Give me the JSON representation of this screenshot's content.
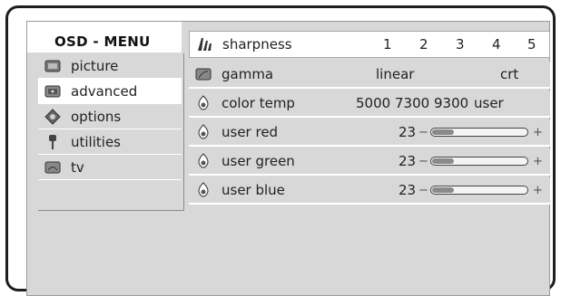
{
  "osd": {
    "title": "OSD - MENU",
    "menu": [
      {
        "label": "picture",
        "icon": "picture-icon",
        "active": false
      },
      {
        "label": "advanced",
        "icon": "advanced-icon",
        "active": true
      },
      {
        "label": "options",
        "icon": "options-icon",
        "active": false
      },
      {
        "label": "utilities",
        "icon": "utilities-icon",
        "active": false
      },
      {
        "label": "tv",
        "icon": "tv-icon",
        "active": false
      }
    ],
    "rows": {
      "sharpness": {
        "label": "sharpness",
        "options": [
          "1",
          "2",
          "3",
          "4",
          "5"
        ]
      },
      "gamma": {
        "label": "gamma",
        "options": [
          "linear",
          "crt"
        ]
      },
      "color_temp": {
        "label": "color temp",
        "options": [
          "5000",
          "7300",
          "9300",
          "user"
        ]
      },
      "user_red": {
        "label": "user red",
        "value": "23",
        "minus": "−",
        "plus": "+",
        "fill_fraction": 0.23
      },
      "user_green": {
        "label": "user green",
        "value": "23",
        "minus": "−",
        "plus": "+",
        "fill_fraction": 0.23
      },
      "user_blue": {
        "label": "user blue",
        "value": "23",
        "minus": "−",
        "plus": "+",
        "fill_fraction": 0.23
      }
    }
  }
}
